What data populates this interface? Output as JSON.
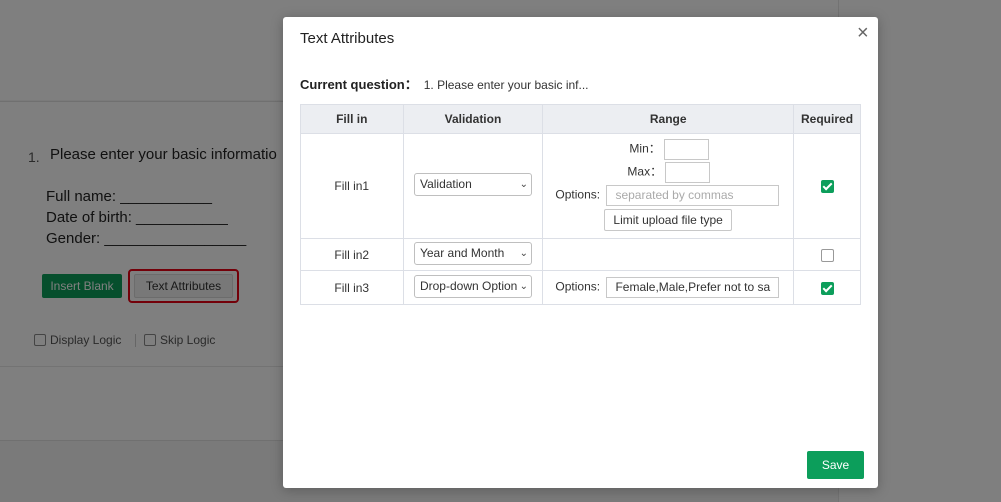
{
  "background": {
    "question_number": "1.",
    "question_title": "Please enter your basic informatio",
    "fields": [
      "Full name: ___________",
      "Date of birth: ___________",
      "Gender: _________________"
    ],
    "insert_blank_label": "Insert Blank",
    "text_attributes_label": "Text Attributes",
    "display_logic_label": "Display Logic",
    "skip_logic_label": "Skip Logic"
  },
  "modal": {
    "title": "Text Attributes",
    "close_symbol": "×",
    "current_question_label": "Current question：",
    "current_question_text": "1. Please enter your basic inf...",
    "headers": [
      "Fill in",
      "Validation",
      "Range",
      "Required"
    ],
    "rows": [
      {
        "name": "Fill in1",
        "validation": "Validation",
        "min_label": "Min：",
        "max_label": "Max：",
        "options_label": "Options:",
        "options_placeholder": "separated by commas",
        "limit_button": "Limit upload file type",
        "required": true
      },
      {
        "name": "Fill in2",
        "validation": "Year and Month",
        "required": false
      },
      {
        "name": "Fill in3",
        "validation": "Drop-down Option",
        "options_label": "Options:",
        "options_value": "Female,Male,Prefer not to sa",
        "required": true
      }
    ],
    "save_label": "Save"
  },
  "colors": {
    "accent_green": "#0c9e5b",
    "highlight_red": "#e60012"
  }
}
